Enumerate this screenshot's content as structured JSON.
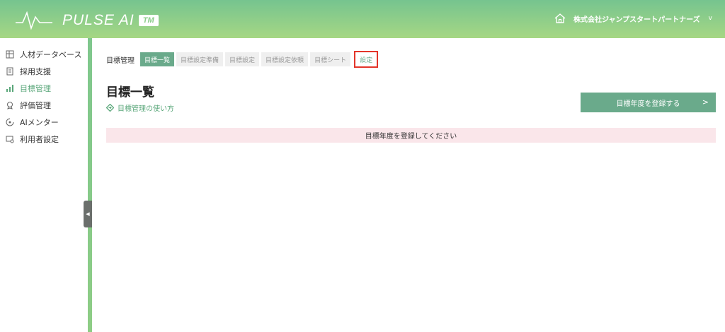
{
  "header": {
    "logo_text": "PULSE AI",
    "logo_tm": "TM",
    "company_name": "株式会社ジャンプスタートパートナーズ",
    "dropdown_glyph": "v",
    "home_icon": "home-icon"
  },
  "sidebar": {
    "items": [
      {
        "label": "人材データベース",
        "icon": "database-icon",
        "active": false
      },
      {
        "label": "採用支援",
        "icon": "document-icon",
        "active": false
      },
      {
        "label": "目標管理",
        "icon": "chart-icon",
        "active": true
      },
      {
        "label": "評価管理",
        "icon": "badge-icon",
        "active": false
      },
      {
        "label": "AIメンター",
        "icon": "mentor-icon",
        "active": false
      },
      {
        "label": "利用者設定",
        "icon": "user-settings-icon",
        "active": false
      }
    ],
    "collapse_glyph": "◀"
  },
  "breadcrumb": {
    "section": "目標管理",
    "tabs": [
      {
        "label": "目標一覧",
        "state": "active"
      },
      {
        "label": "目標設定準備",
        "state": "normal"
      },
      {
        "label": "目標設定",
        "state": "normal"
      },
      {
        "label": "目標設定依頼",
        "state": "normal"
      },
      {
        "label": "目標シート",
        "state": "normal"
      },
      {
        "label": "設定",
        "state": "highlight"
      }
    ]
  },
  "main": {
    "title": "目標一覧",
    "help_link": "目標管理の使い方",
    "register_button": "目標年度を登録する",
    "register_arrow": ">",
    "notice": "目標年度を登録してください"
  },
  "colors": {
    "accent": "#6aaa8b",
    "header_start": "#76c48f",
    "header_end": "#a6d784",
    "notice_bg": "#fae6ea",
    "highlight_border": "#e3352a"
  }
}
